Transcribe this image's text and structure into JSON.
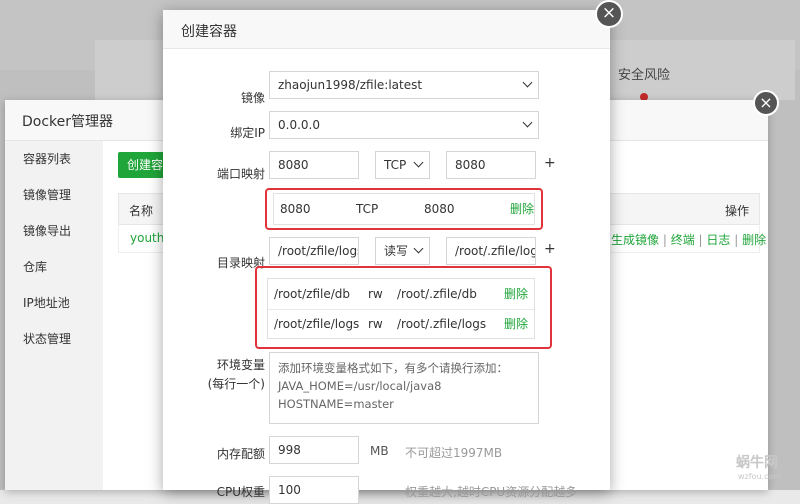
{
  "background": {
    "risk_label": "安全风险"
  },
  "docker": {
    "title": "Docker管理器",
    "sidebar": [
      {
        "label": "容器列表"
      },
      {
        "label": "镜像管理"
      },
      {
        "label": "镜像导出"
      },
      {
        "label": "仓库"
      },
      {
        "label": "IP地址池"
      },
      {
        "label": "状态管理"
      }
    ],
    "create_button": "创建容器",
    "table": {
      "headers": {
        "name": "名称",
        "ops": "操作"
      },
      "row": {
        "name": "youthfu",
        "ops": [
          "生成镜像",
          "终端",
          "日志",
          "删除"
        ]
      }
    }
  },
  "modal": {
    "title": "创建容器",
    "image": {
      "label": "镜像",
      "value": "zhaojun1998/zfile:latest"
    },
    "bind_ip": {
      "label": "绑定IP",
      "value": "0.0.0.0"
    },
    "port": {
      "label": "端口映射",
      "host": "8080",
      "protocol": "TCP",
      "container": "8080",
      "plus": "+",
      "list": [
        {
          "host": "8080",
          "protocol": "TCP",
          "container": "8080",
          "action": "删除"
        }
      ]
    },
    "volume": {
      "label": "目录映射",
      "host": "/root/zfile/logs",
      "mode": "读写",
      "container": "/root/.zfile/logs",
      "plus": "+",
      "list": [
        {
          "host": "/root/zfile/db",
          "mode": "rw",
          "container": "/root/.zfile/db",
          "action": "删除"
        },
        {
          "host": "/root/zfile/logs",
          "mode": "rw",
          "container": "/root/.zfile/logs",
          "action": "删除"
        }
      ]
    },
    "env": {
      "label": "环境变量",
      "label2": "(每行一个)",
      "lines": [
        "添加环境变量格式如下，有多个请换行添加：",
        "JAVA_HOME=/usr/local/java8",
        "HOSTNAME=master"
      ]
    },
    "memory": {
      "label": "内存配额",
      "value": "998",
      "unit": "MB",
      "hint": "不可超过1997MB"
    },
    "cpu": {
      "label": "CPU权重",
      "value": "100",
      "hint": "权重越大,越时CPU资源分配越多"
    }
  },
  "watermark": {
    "text": "蜗牛网",
    "sub": "wzfou.com"
  },
  "colors": {
    "accent": "#20a53a",
    "highlight": "#e0343a"
  }
}
